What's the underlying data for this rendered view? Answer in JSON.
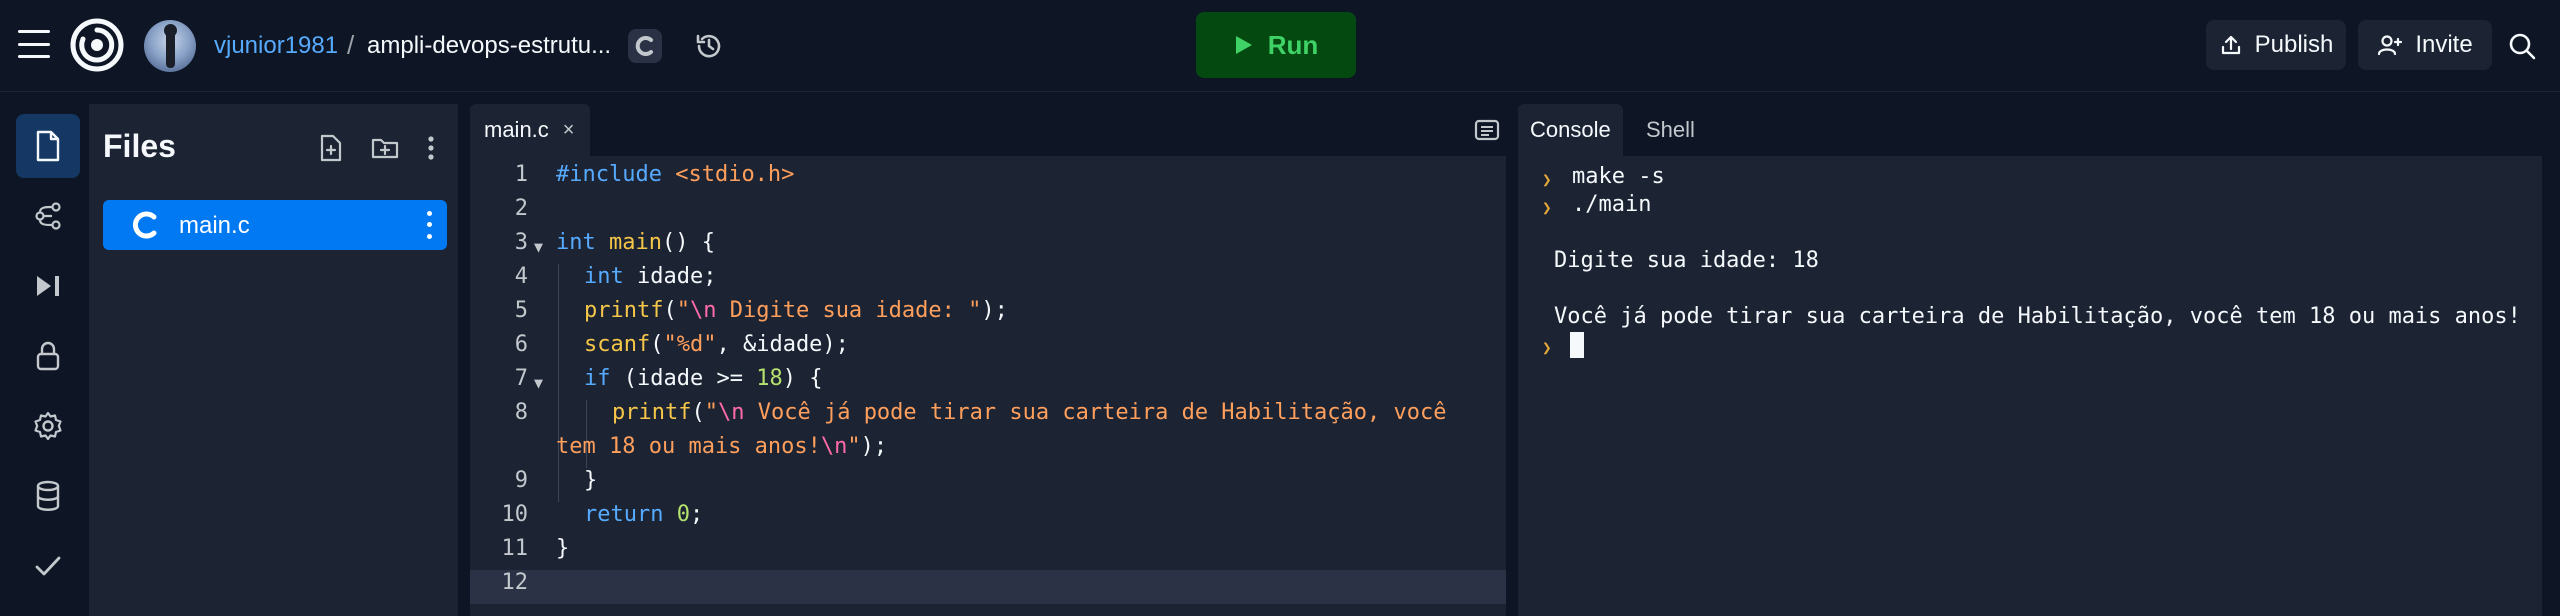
{
  "topbar": {
    "menu_icon": "hamburger-icon",
    "logo_icon": "replit-logo-icon",
    "username": "vjunior1981",
    "separator": "/",
    "repl_name": "ampli-devops-estrutu...",
    "language_badge": "C",
    "history_icon": "history-icon",
    "run_label": "Run",
    "publish_label": "Publish",
    "invite_label": "Invite",
    "search_icon": "search-icon"
  },
  "rail": {
    "items": [
      "files-icon",
      "git-branch-icon",
      "debugger-icon",
      "secrets-lock-icon",
      "settings-gear-icon",
      "database-icon",
      "checkmark-icon"
    ]
  },
  "files_panel": {
    "title": "Files",
    "new_file_icon": "new-file-icon",
    "new_folder_icon": "new-folder-icon",
    "more_icon": "more-vertical-icon",
    "files": [
      {
        "name": "main.c",
        "icon": "c-language-icon",
        "selected": true
      }
    ]
  },
  "editor": {
    "tab_label": "main.c",
    "tab_close": "×",
    "line_numbers": [
      "1",
      "2",
      "3",
      "4",
      "5",
      "6",
      "7",
      "8",
      "",
      "9",
      "10",
      "11",
      "12"
    ],
    "current_line": "12",
    "lines": {
      "l1_inc": "#include",
      "l1_hdr": " <stdio.h>",
      "l3_type": "int",
      "l3_fn": " main",
      "l3_rest": "() {",
      "l4_type": "int",
      "l4_rest": " idade;",
      "l5_fn": "printf",
      "l5_p1": "(",
      "l5_q1": "\"",
      "l5_esc": "\\n",
      "l5_str": " Digite sua idade: \"",
      "l5_rest": ");",
      "l6_fn": "scanf",
      "l6_p1": "(",
      "l6_str": "\"%d\"",
      "l6_rest": ", &idade);",
      "l7_kw": "if",
      "l7_a": " (idade >= ",
      "l7_num": "18",
      "l7_b": ") {",
      "l8_fn": "printf",
      "l8_p1": "(",
      "l8_q1": "\"",
      "l8_esc": "\\n",
      "l8_str": " Você já pode tirar sua carteira de Habilitação, você",
      "l8b_str": "tem 18 ou mais anos!",
      "l8b_esc": "\\n",
      "l8b_q": "\"",
      "l8b_rest": ");",
      "l9": "}",
      "l10_kw": "return",
      "l10_num": " 0",
      "l10_rest": ";",
      "l11": "}"
    }
  },
  "console": {
    "tabs": [
      "Console",
      "Shell"
    ],
    "active_tab": "Console",
    "lines": [
      "make -s",
      "./main",
      "Digite sua idade: 18",
      "Você já pode tirar sua carteira de Habilitação, você tem 18 ou mais anos!"
    ]
  }
}
